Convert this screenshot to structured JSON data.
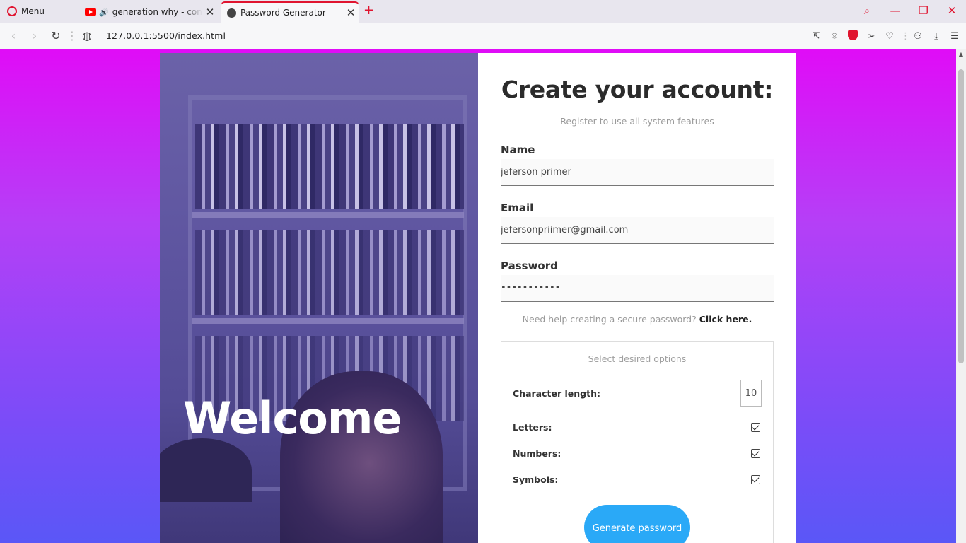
{
  "browser": {
    "menu_label": "Menu",
    "tabs": [
      {
        "title": "generation why - conan gray"
      },
      {
        "title": "Password Generator"
      }
    ],
    "new_tab": "+",
    "url": "127.0.0.1:5500/index.html"
  },
  "hero": {
    "welcome": "Welcome"
  },
  "form": {
    "title": "Create your account:",
    "subtitle": "Register to use all system features",
    "name_label": "Name",
    "name_value": "jeferson primer",
    "email_label": "Email",
    "email_value": "jefersonpriimer@gmail.com",
    "password_label": "Password",
    "password_value": "•••••••••••",
    "help_text": "Need help creating a secure password?",
    "help_link": "Click here."
  },
  "options": {
    "title": "Select desired options",
    "length_label": "Character length:",
    "length_value": "10",
    "letters_label": "Letters:",
    "numbers_label": "Numbers:",
    "symbols_label": "Symbols:",
    "letters_checked": true,
    "numbers_checked": true,
    "symbols_checked": true,
    "generate_label": "Generate password"
  },
  "colors": {
    "accent": "#e0142f",
    "button": "#2aa9f7",
    "gradient_top": "#e00cf7",
    "gradient_bottom": "#5a57f7"
  }
}
